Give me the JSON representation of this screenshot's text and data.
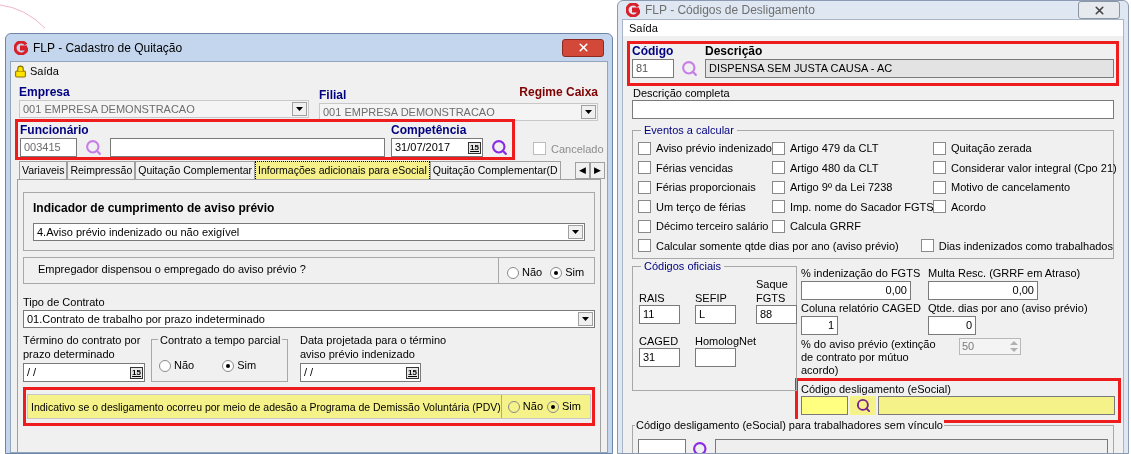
{
  "left_window": {
    "title": "FLP - Cadastro de Quitação",
    "active": true,
    "menu": [
      {
        "label": "Saída"
      }
    ],
    "empresa": {
      "label": "Empresa",
      "value": "001 EMPRESA DEMONSTRACAO"
    },
    "filial": {
      "label": "Filial",
      "value": "001 EMPRESA DEMONSTRACAO"
    },
    "regime": "Regime Caixa",
    "employee_section": {
      "highlighted": true,
      "funcionario": {
        "label": "Funcionário",
        "code": "003415"
      },
      "competencia": {
        "label": "Competência",
        "value": "31/07/2017",
        "button": "15"
      }
    },
    "cancelado": {
      "label": "Cancelado",
      "checked": false,
      "disabled": true
    },
    "tabs": [
      {
        "label": "Variaveis",
        "selected": false
      },
      {
        "label": "Reimpressão",
        "selected": false
      },
      {
        "label": "Quitação Complementar",
        "selected": false
      },
      {
        "label": "Informações adicionais para eSocial",
        "selected": true
      },
      {
        "label": "Quitação Complementar(D",
        "selected": false
      }
    ],
    "tab_scroll": [
      "◀",
      "▶"
    ],
    "aviso": {
      "title": "Indicador de cumprimento de aviso prévio",
      "value": "4.Aviso prévio indenizado ou não exigível"
    },
    "empregador": {
      "question": "Empregador dispensou o empregado do aviso prévio ?",
      "options": [
        {
          "label": "Não",
          "selected": false
        },
        {
          "label": "Sim",
          "selected": true
        }
      ]
    },
    "tipo_contrato": {
      "label": "Tipo de Contrato",
      "value": "01.Contrato de trabalho por prazo indeterminado"
    },
    "termino": {
      "label": "Término do contrato por prazo determinado",
      "value": "/ /",
      "button": "15"
    },
    "tempo_parcial": {
      "title": "Contrato a tempo parcial",
      "options": [
        {
          "label": "Não",
          "selected": false
        },
        {
          "label": "Sim",
          "selected": true
        }
      ]
    },
    "data_projetada": {
      "label": "Data projetada para o término aviso prévio indenizado",
      "value": "/ /",
      "button": "15"
    },
    "pdv": {
      "highlighted": true,
      "question": "Indicativo se o desligamento ocorreu por meio de adesão a Programa de Demissão Voluntária (PDV)",
      "options": [
        {
          "label": "Não",
          "selected": false
        },
        {
          "label": "Sim",
          "selected": true
        }
      ]
    }
  },
  "right_window": {
    "title": "FLP - Códigos de Desligamento",
    "active": false,
    "menu": [
      {
        "label": "Saída"
      }
    ],
    "code_section": {
      "highlighted": true,
      "codigo": {
        "label": "Código",
        "value": "81"
      },
      "descricao": {
        "label": "Descrição",
        "value": "DISPENSA SEM JUSTA CAUSA - AC"
      }
    },
    "descricao_completa": {
      "label": "Descrição completa"
    },
    "eventos": {
      "title": "Eventos a calcular",
      "columns": [
        [
          {
            "label": "Aviso prévio indenizado",
            "checked": false
          },
          {
            "label": "Férias vencidas",
            "checked": false
          },
          {
            "label": "Férias proporcionais",
            "checked": false
          },
          {
            "label": "Um terço de férias",
            "checked": false
          },
          {
            "label": "Décimo terceiro salário",
            "checked": false
          }
        ],
        [
          {
            "label": "Artigo 479 da CLT",
            "checked": false
          },
          {
            "label": "Artigo 480 da CLT",
            "checked": false
          },
          {
            "label": "Artigo 9º da Lei 7238",
            "checked": false
          },
          {
            "label": "Imp. nome do Sacador FGTS",
            "checked": false
          },
          {
            "label": "Calcula GRRF",
            "checked": false
          }
        ],
        [
          {
            "label": "Quitação zerada",
            "checked": false
          },
          {
            "label": "Considerar valor integral (Cpo 21)",
            "checked": false
          },
          {
            "label": "Motivo de cancelamento",
            "checked": false
          },
          {
            "label": "Acordo",
            "checked": false
          }
        ]
      ],
      "wide_items": [
        {
          "label": "Calcular somente qtde dias por ano (aviso prévio)",
          "checked": false
        },
        {
          "label": "Dias indenizados como trabalhados",
          "checked": false
        }
      ]
    },
    "codigos_oficiais": {
      "title": "Códigos oficiais",
      "fields": [
        {
          "label": "RAIS",
          "value": "11"
        },
        {
          "label": "SEFIP",
          "value": "L"
        },
        {
          "label": "Saque FGTS",
          "value": "88"
        },
        {
          "label": "CAGED",
          "value": "31"
        },
        {
          "label": "HomologNet"
        }
      ]
    },
    "valores": [
      {
        "label": "% indenização do FGTS",
        "value": "0,00"
      },
      {
        "label": "Multa Resc. (GRRF em Atraso)",
        "value": "0,00"
      },
      {
        "label": "Coluna relatório CAGED",
        "value": "1"
      },
      {
        "label": "Qtde. dias por ano (aviso prévio)",
        "value": "0"
      }
    ],
    "aviso_percent": {
      "label": "% do aviso prévio (extinção de contrato por mútuo acordo)",
      "value": "50",
      "disabled": true
    },
    "esocial": {
      "highlighted": true,
      "label": "Código desligamento (eSocial)"
    },
    "sem_vinculo": {
      "label": "Código desligamento (eSocial) para trabalhadores sem vínculo"
    }
  }
}
